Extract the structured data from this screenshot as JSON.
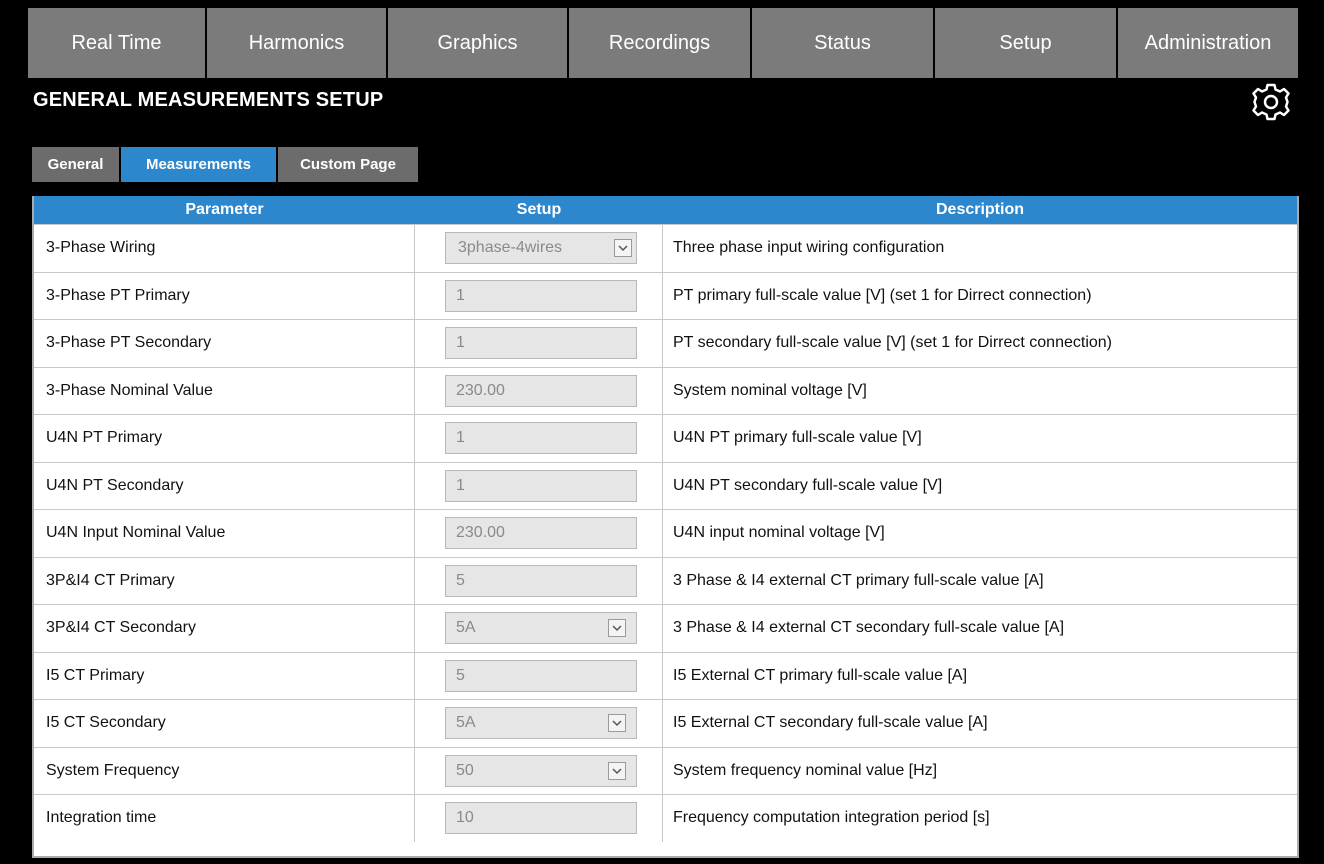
{
  "nav": {
    "items": [
      {
        "label": "Real Time"
      },
      {
        "label": "Harmonics"
      },
      {
        "label": "Graphics"
      },
      {
        "label": "Recordings"
      },
      {
        "label": "Status"
      },
      {
        "label": "Setup"
      },
      {
        "label": "Administration"
      }
    ]
  },
  "page": {
    "title": "GENERAL MEASUREMENTS SETUP",
    "settings_icon": "gear-icon"
  },
  "tabs": [
    {
      "label": "General",
      "active": false
    },
    {
      "label": "Measurements",
      "active": true
    },
    {
      "label": "Custom Page",
      "active": false
    }
  ],
  "table": {
    "headers": [
      "Parameter",
      "Setup",
      "Description"
    ],
    "rows": [
      {
        "parameter": "3-Phase Wiring",
        "value": "3phase-4wires",
        "type": "select",
        "description": "Three phase input wiring configuration"
      },
      {
        "parameter": "3-Phase PT Primary",
        "value": "1",
        "type": "input",
        "description": "PT primary full-scale value [V] (set 1 for Dirrect connection)"
      },
      {
        "parameter": "3-Phase PT Secondary",
        "value": "1",
        "type": "input",
        "description": "PT secondary full-scale value [V] (set 1 for Dirrect connection)"
      },
      {
        "parameter": "3-Phase Nominal Value",
        "value": "230.00",
        "type": "input",
        "description": "System nominal voltage [V]"
      },
      {
        "parameter": "U4N PT Primary",
        "value": "1",
        "type": "input",
        "description": "U4N PT primary full-scale value [V]"
      },
      {
        "parameter": "U4N PT Secondary",
        "value": "1",
        "type": "input",
        "description": "U4N PT secondary full-scale value [V]"
      },
      {
        "parameter": "U4N Input Nominal Value",
        "value": "230.00",
        "type": "input",
        "description": "U4N input nominal voltage [V]"
      },
      {
        "parameter": "3P&I4 CT Primary",
        "value": "5",
        "type": "input",
        "description": "3 Phase & I4 external CT primary full-scale value [A]"
      },
      {
        "parameter": "3P&I4 CT Secondary",
        "value": "5A",
        "type": "select",
        "description": "3 Phase & I4 external CT secondary full-scale value [A]"
      },
      {
        "parameter": "I5 CT Primary",
        "value": "5",
        "type": "input",
        "description": "I5 External CT primary full-scale value [A]"
      },
      {
        "parameter": "I5 CT Secondary",
        "value": "5A",
        "type": "select",
        "description": "I5 External CT secondary full-scale value [A]"
      },
      {
        "parameter": "System Frequency",
        "value": "50",
        "type": "select",
        "description": "System frequency nominal value [Hz]"
      },
      {
        "parameter": "Integration time",
        "value": "10",
        "type": "input",
        "description": "Frequency computation integration period [s]"
      }
    ]
  },
  "colors": {
    "accent": "#2d87cc",
    "nav_bg": "#7b7b7b",
    "tab_bg": "#6c6c6c",
    "background": "#000000"
  }
}
